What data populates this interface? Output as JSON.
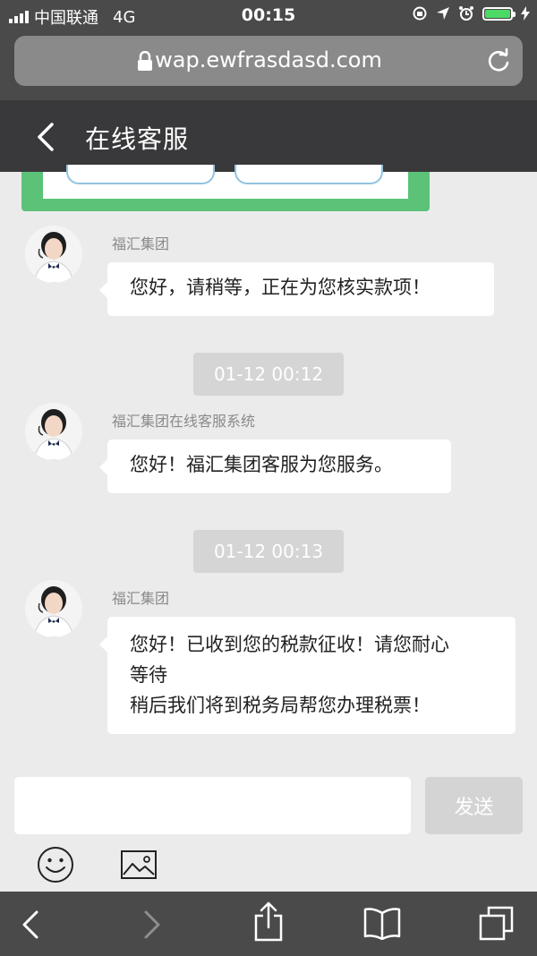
{
  "status_bar": {
    "carrier": "中国联通",
    "network": "4G",
    "time": "00:15"
  },
  "browser": {
    "url": "wap.ewfrasdasd.com"
  },
  "header": {
    "title": "在线客服"
  },
  "messages": [
    {
      "sender": "福汇集团",
      "lines": [
        "您好，请稍等，正在为您核实款项！"
      ]
    },
    {
      "timestamp": "01-12 00:12",
      "sender": "福汇集团在线客服系统",
      "lines": [
        "您好！福汇集团客服为您服务。"
      ]
    },
    {
      "timestamp": "01-12 00:13",
      "sender": "福汇集团",
      "lines": [
        "您好！已收到您的税款征收！请您耐心",
        "等待",
        "稍后我们将到税务局帮您办理税票！"
      ]
    }
  ],
  "composer": {
    "input_value": "",
    "send_label": "发送"
  },
  "colors": {
    "status_bg": "#4a4a4a",
    "header_bg": "#39393b",
    "chat_bg": "#ebebeb",
    "card_green": "#5bc278",
    "battery_green": "#4cd964"
  },
  "icons": [
    "lock-icon",
    "reload-icon",
    "back-icon",
    "emoji-icon",
    "image-icon",
    "browser-back-icon",
    "browser-forward-icon",
    "share-icon",
    "bookmarks-icon",
    "tabs-icon"
  ]
}
